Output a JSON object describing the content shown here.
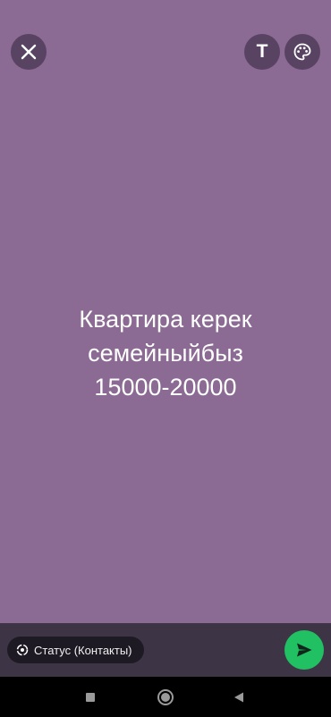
{
  "colors": {
    "background": "#8b6a93",
    "bottom_bar": "#3d3446",
    "send": "#21c063"
  },
  "status": {
    "text": "Квартира керек\nсемейныйбыз \n15000-20000"
  },
  "toolbar": {
    "close_icon": "close-icon",
    "text_icon": "text-tool-icon",
    "text_glyph": "T",
    "palette_icon": "palette-icon"
  },
  "footer": {
    "audience_label": "Статус (Контакты)",
    "audience_icon": "status-ring-icon",
    "send_icon": "send-icon"
  },
  "navigation": {
    "recents_icon": "square-recents-icon",
    "home_icon": "circle-home-icon",
    "back_icon": "triangle-back-icon"
  }
}
